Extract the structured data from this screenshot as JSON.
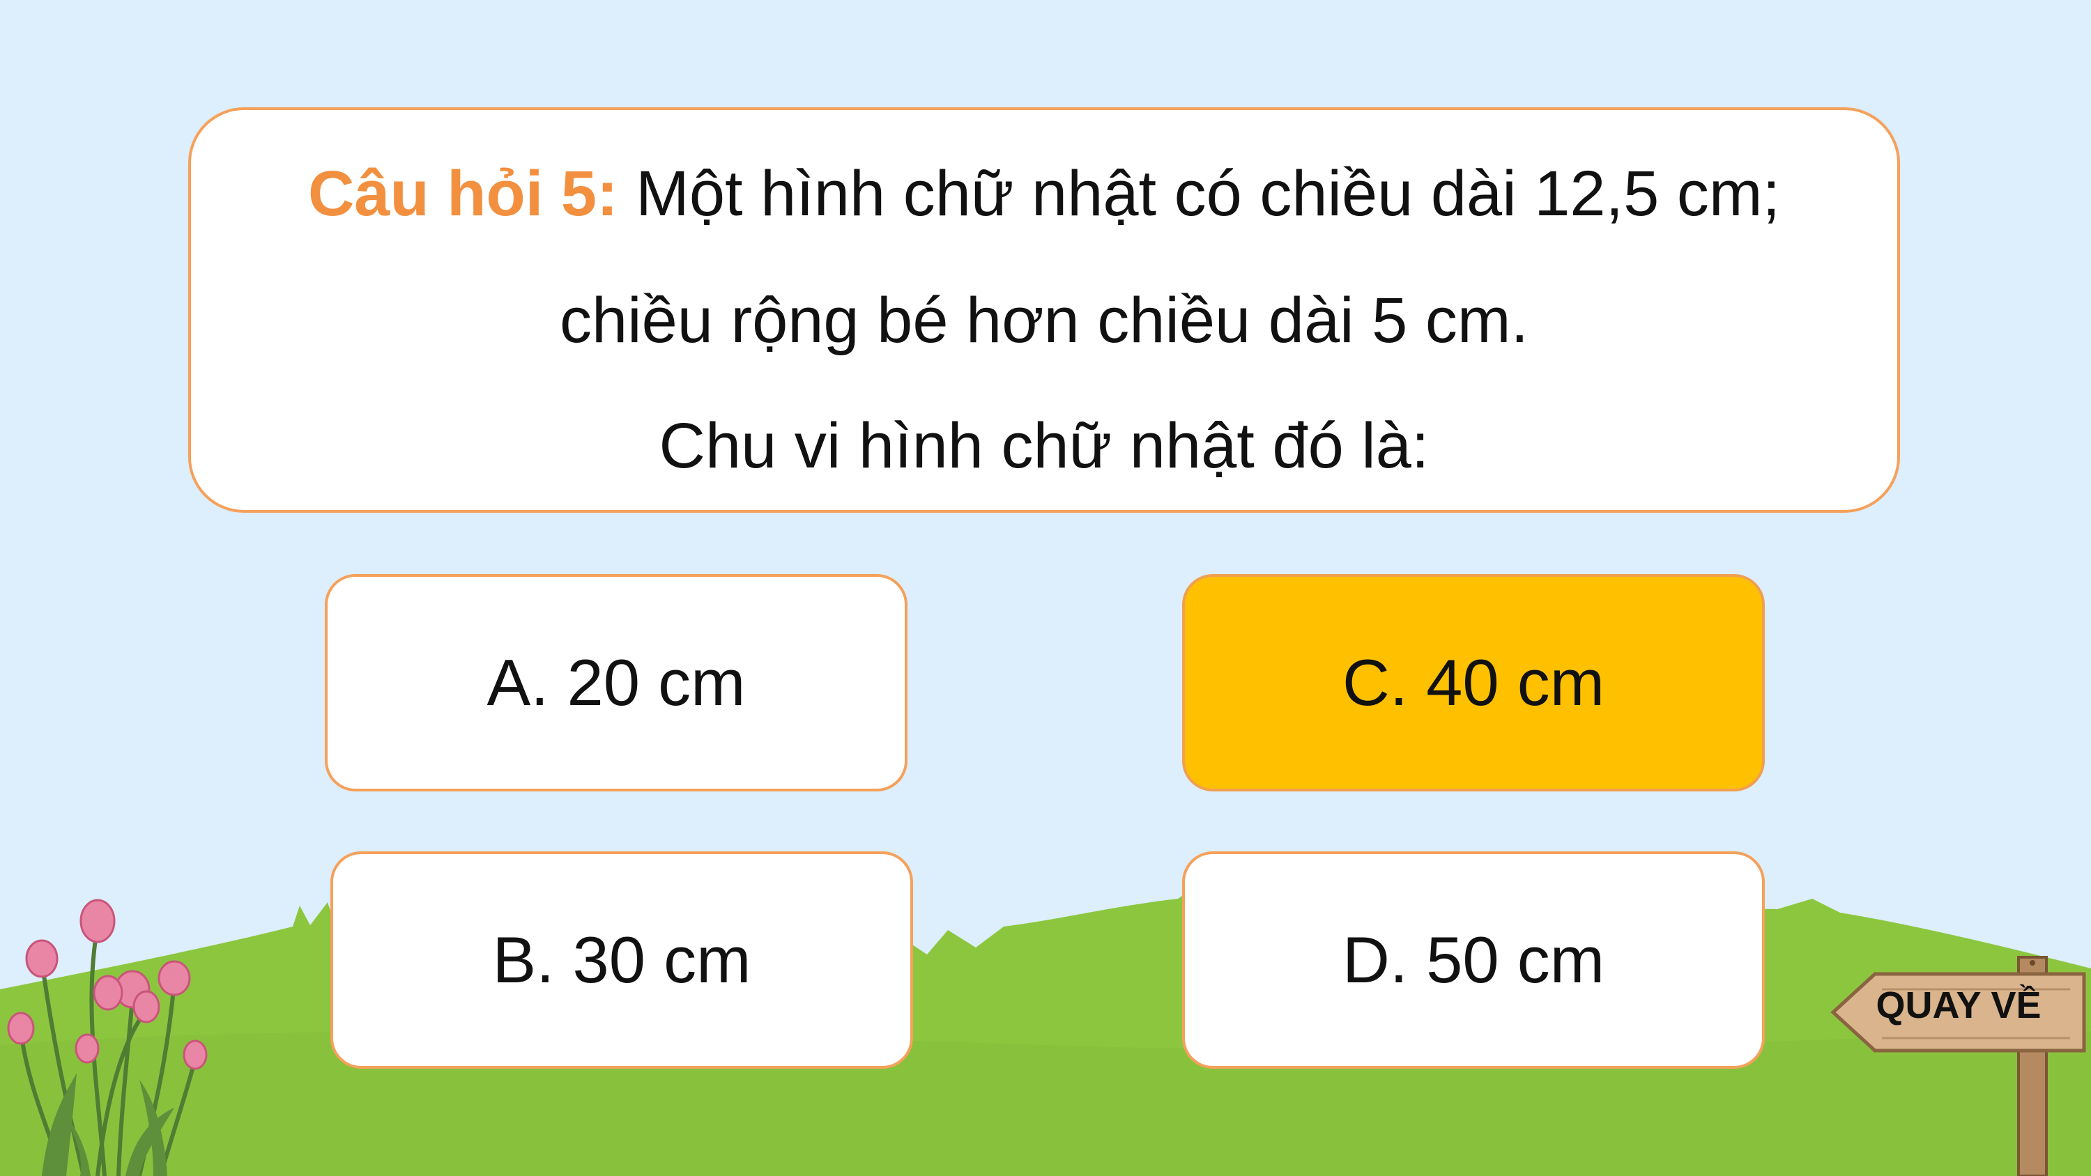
{
  "question": {
    "label": "Câu hỏi 5:",
    "line1": " Một hình chữ nhật có chiều dài 12,5 cm;",
    "line2": "chiều rộng bé hơn chiều dài 5 cm.",
    "line3": "Chu vi hình chữ nhật đó là:"
  },
  "answers": {
    "a": "A. 20 cm",
    "b": "B. 30 cm",
    "c": "C. 40 cm",
    "d": "D. 50 cm"
  },
  "navigation": {
    "back_label": "QUAY VỀ"
  },
  "colors": {
    "sky": "#ddeefc",
    "grass": "#8cc63f",
    "accent_orange": "#f29040",
    "selected_answer": "#ffc000",
    "signpost_wood": "#c9a37c"
  },
  "icons": [
    "flower-plant-decoration",
    "wooden-signpost-icon",
    "grass-hill-background"
  ]
}
